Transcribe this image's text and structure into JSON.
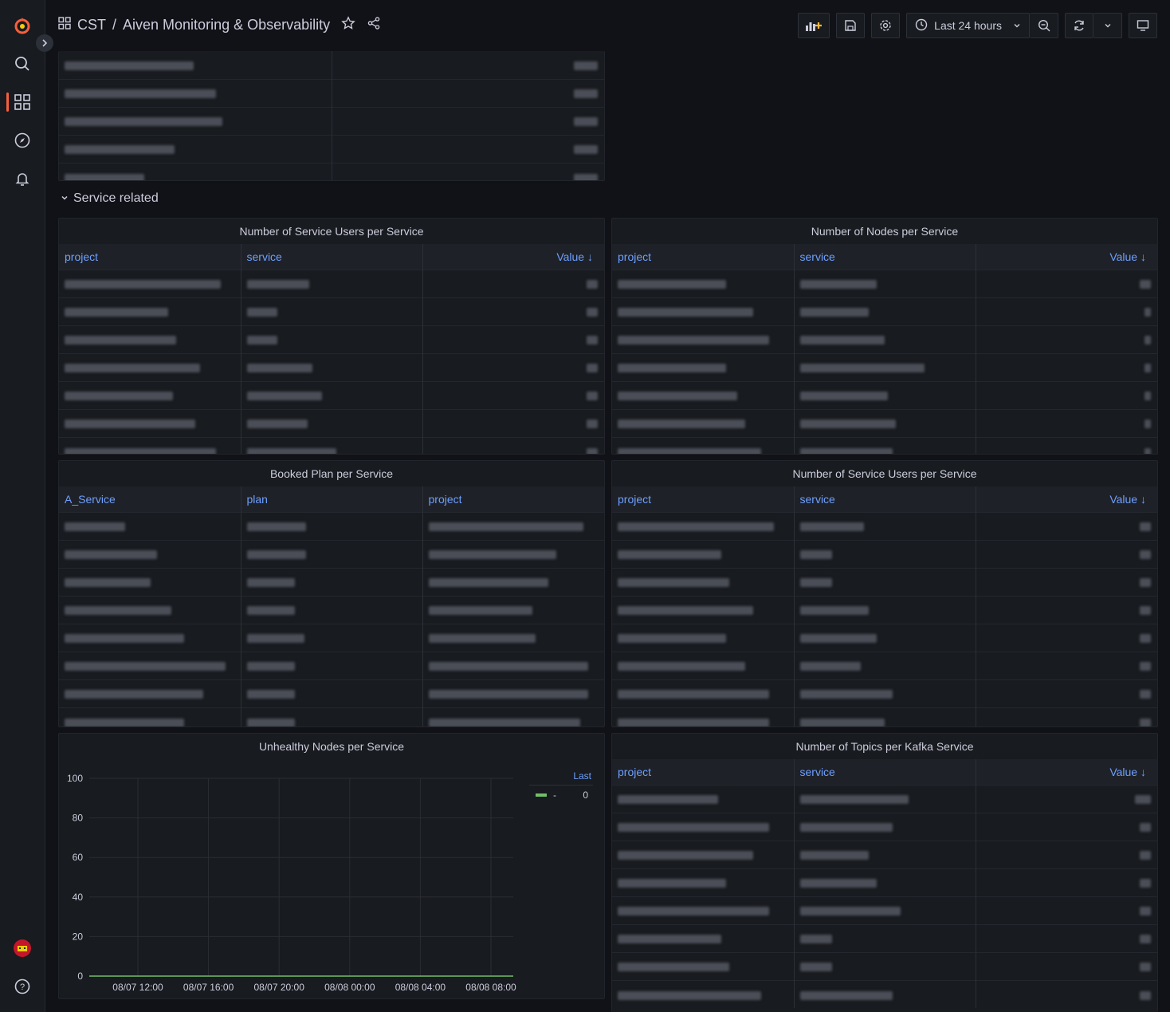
{
  "breadcrumb": {
    "folder": "CST",
    "separator": "/",
    "dashboard": "Aiven Monitoring & Observability"
  },
  "toolbar": {
    "time_range": "Last 24 hours"
  },
  "row": {
    "title": "Service related"
  },
  "panels": {
    "users1": {
      "title": "Number of Service Users per Service",
      "columns": [
        "project",
        "service",
        "Value"
      ]
    },
    "nodes": {
      "title": "Number of Nodes per Service",
      "columns": [
        "project",
        "service",
        "Value"
      ]
    },
    "plan": {
      "title": "Booked Plan per Service",
      "columns": [
        "A_Service",
        "plan",
        "project"
      ]
    },
    "users2": {
      "title": "Number of Service Users per Service",
      "columns": [
        "project",
        "service",
        "Value"
      ]
    },
    "unhealthy": {
      "title": "Unhealthy Nodes per Service",
      "legend_header": "Last",
      "legend_name": "-",
      "legend_value": "0"
    },
    "topics": {
      "title": "Number of Topics per Kafka Service",
      "columns": [
        "project",
        "service",
        "Value"
      ]
    }
  },
  "sort_arrow": "↓",
  "colors": {
    "accent": "#6e9fff",
    "brand": "#f55f3e",
    "series": "#73bf69"
  },
  "chart_data": {
    "type": "line",
    "title": "Unhealthy Nodes per Service",
    "x": [
      "08/07 12:00",
      "08/07 16:00",
      "08/07 20:00",
      "08/08 00:00",
      "08/08 04:00",
      "08/08 08:00"
    ],
    "yticks": [
      "0",
      "20",
      "40",
      "60",
      "80",
      "100"
    ],
    "ylim": [
      0,
      100
    ],
    "series": [
      {
        "name": "-",
        "values": [
          0,
          0,
          0,
          0,
          0,
          0
        ]
      }
    ],
    "grid": true,
    "legend": "right"
  }
}
